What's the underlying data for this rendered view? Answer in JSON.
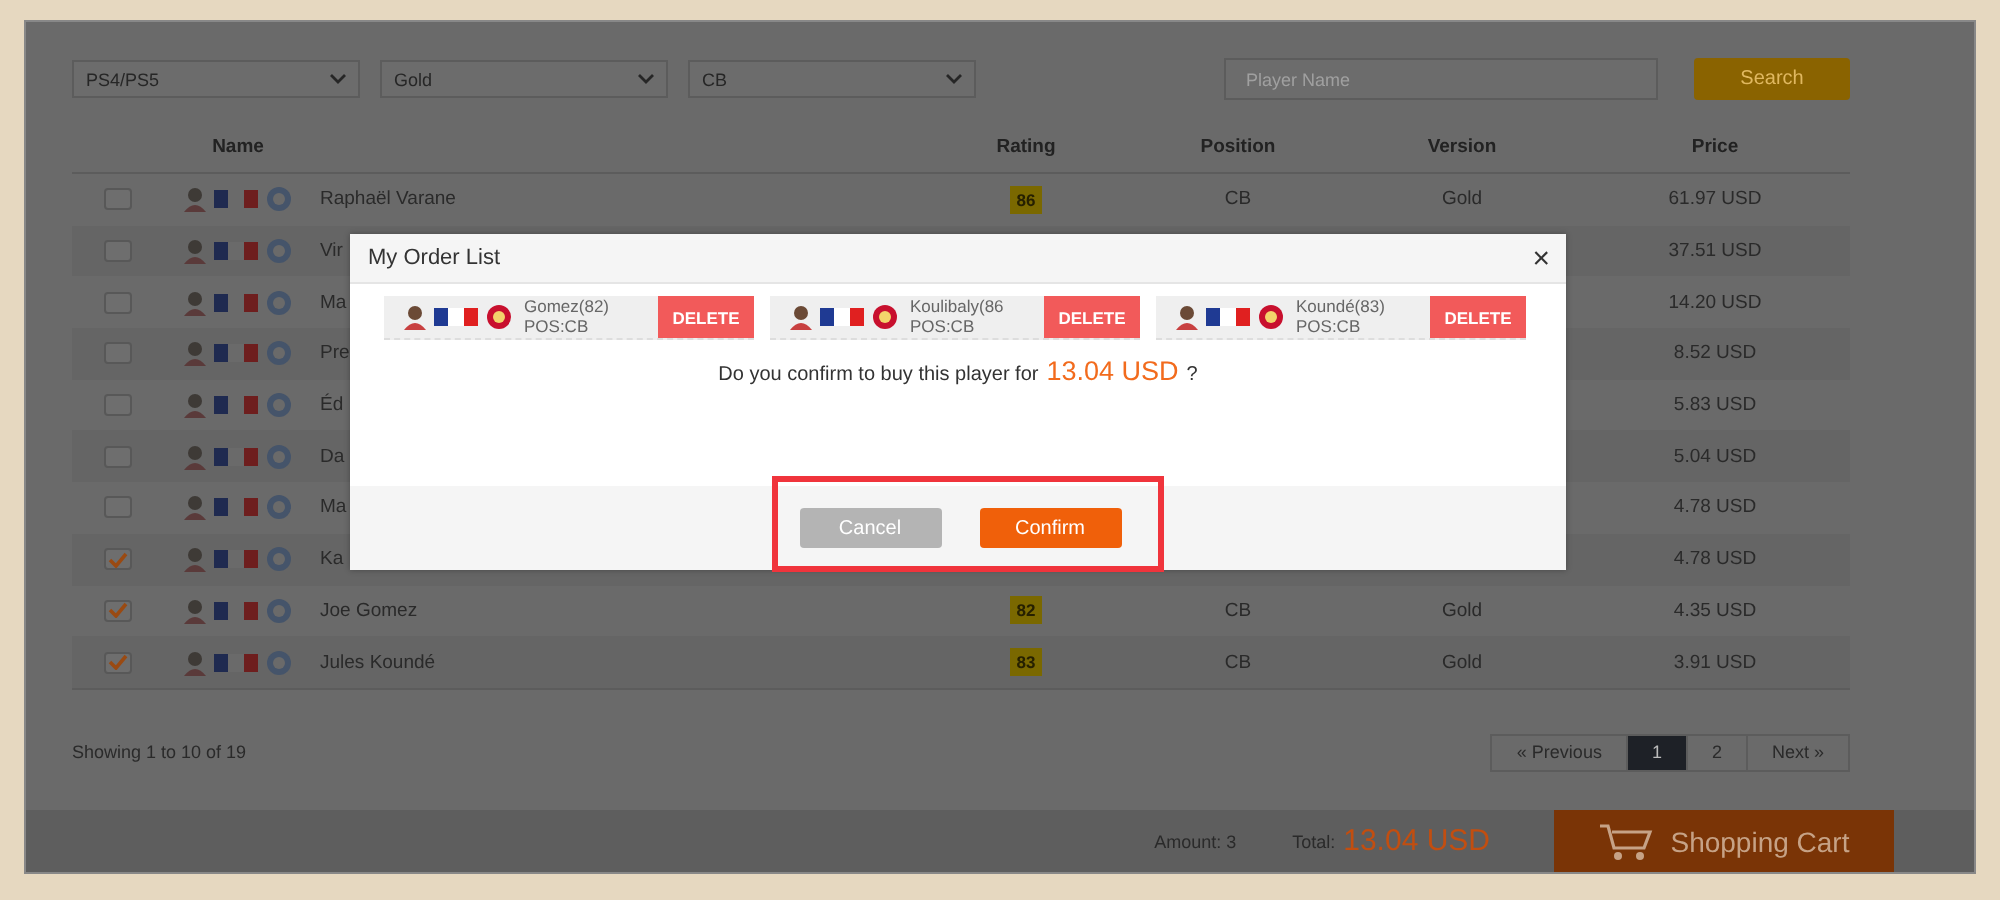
{
  "filters": [
    {
      "kind": "select",
      "value": "PS4/PS5"
    },
    {
      "kind": "select",
      "value": "Gold"
    },
    {
      "kind": "select",
      "value": "CB"
    }
  ],
  "search": {
    "placeholder": "Player Name",
    "button": "Search"
  },
  "table": {
    "columns": [
      "Name",
      "Rating",
      "Position",
      "Version",
      "Price"
    ],
    "rows": [
      {
        "checked": false,
        "name": "Raphaël Varane",
        "rating": "86",
        "position": "CB",
        "version": "Gold",
        "price": "61.97 USD"
      },
      {
        "checked": false,
        "name": "Vir",
        "price": "37.51 USD"
      },
      {
        "checked": false,
        "name": "Ma",
        "price": "14.20 USD"
      },
      {
        "checked": false,
        "name": "Pre",
        "price": "8.52 USD"
      },
      {
        "checked": false,
        "name": "Éd",
        "price": "5.83 USD"
      },
      {
        "checked": false,
        "name": "Da",
        "price": "5.04 USD"
      },
      {
        "checked": false,
        "name": "Ma",
        "price": "4.78 USD"
      },
      {
        "checked": true,
        "name": "Ka",
        "price": "4.78 USD"
      },
      {
        "checked": true,
        "name": "Joe Gomez",
        "rating": "82",
        "position": "CB",
        "version": "Gold",
        "price": "4.35 USD"
      },
      {
        "checked": true,
        "name": "Jules Koundé",
        "rating": "83",
        "position": "CB",
        "version": "Gold",
        "price": "3.91 USD"
      }
    ]
  },
  "showing": "Showing 1 to 10 of 19",
  "pagination": [
    {
      "label": "« Previous",
      "selected": false
    },
    {
      "label": "1",
      "selected": true
    },
    {
      "label": "2",
      "selected": false
    },
    {
      "label": "Next »",
      "selected": false
    }
  ],
  "footer": {
    "amount": "Amount: 3",
    "total_label": "Total:",
    "total": "13.04 USD",
    "cart_button": "Shopping Cart"
  },
  "modal": {
    "title": "My Order List",
    "close": "×",
    "items": [
      {
        "name": "Gomez(82)",
        "position": "POS:CB",
        "delete": "DELETE"
      },
      {
        "name": "Koulibaly(86",
        "position": "POS:CB",
        "delete": "DELETE"
      },
      {
        "name": "Koundé(83)",
        "position": "POS:CB",
        "delete": "DELETE"
      }
    ],
    "message": "Do you confirm to buy this player for",
    "amount": "13.04 USD",
    "suffix": "?",
    "buttons": [
      {
        "kind": "cancel",
        "label": "Cancel"
      },
      {
        "kind": "confirm",
        "label": "Confirm"
      }
    ]
  }
}
